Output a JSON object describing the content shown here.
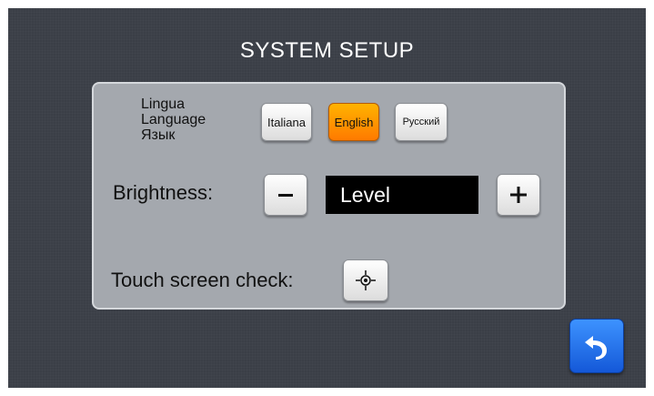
{
  "header": {
    "title": "SYSTEM SETUP"
  },
  "language": {
    "labels": [
      "Lingua",
      "Language",
      "Язык"
    ],
    "options": [
      {
        "label": "Italiana",
        "selected": false
      },
      {
        "label": "English",
        "selected": true
      },
      {
        "label": "Русский",
        "selected": false
      }
    ],
    "accent_color": "#ff8c00"
  },
  "brightness": {
    "label": "Brightness:",
    "value_text": "Level",
    "decrease_icon": "minus-icon",
    "increase_icon": "plus-icon"
  },
  "touch_check": {
    "label": "Touch screen check:",
    "icon": "crosshair-icon"
  },
  "navigation": {
    "back_icon": "back-arrow-icon",
    "back_color": "#1f6fe8"
  }
}
